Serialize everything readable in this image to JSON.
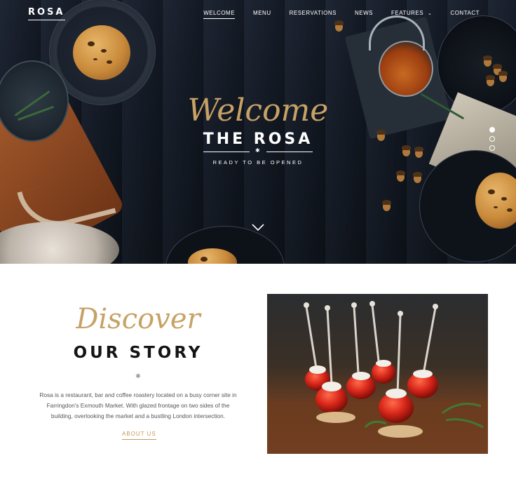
{
  "brand": {
    "logo": "ROSA"
  },
  "nav": {
    "items": [
      {
        "label": "WELCOME",
        "active": true
      },
      {
        "label": "MENU"
      },
      {
        "label": "RESERVATIONS"
      },
      {
        "label": "NEWS"
      },
      {
        "label": "FEATURES",
        "has_dropdown": true
      },
      {
        "label": "CONTACT"
      }
    ]
  },
  "hero": {
    "script_title": "Welcome",
    "title": "THE ROSA",
    "subtitle": "READY TO BE OPENED",
    "slides": {
      "count": 3,
      "active_index": 0
    }
  },
  "story": {
    "script_title": "Discover",
    "title": "OUR STORY",
    "text": "Rosa is a restaurant, bar and coffee roastery located on a busy corner site in Farringdon's Exmouth Market. With glazed frontage on two sides of the building, overlooking the market and a bustling London intersection.",
    "link_label": "ABOUT US"
  },
  "colors": {
    "accent_gold": "#c7a266",
    "hero_bg": "#141b27",
    "heading": "#141414"
  }
}
